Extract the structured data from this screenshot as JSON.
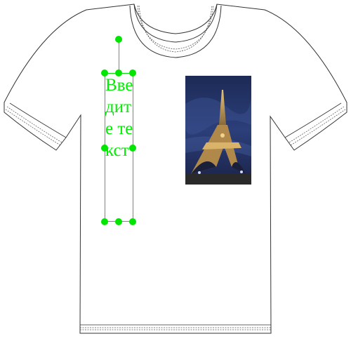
{
  "canvas": {
    "shirt_color": "#ffffff",
    "outline_color": "#333333"
  },
  "text_object": {
    "content": "Введите текст",
    "color": "#00ee00",
    "selected": true
  },
  "photo": {
    "subject": "eiffel-tower-night"
  },
  "handles": [
    "rotate",
    "top-left",
    "top-center",
    "top-right",
    "middle-left",
    "middle-right",
    "bottom-left",
    "bottom-center",
    "bottom-right"
  ]
}
